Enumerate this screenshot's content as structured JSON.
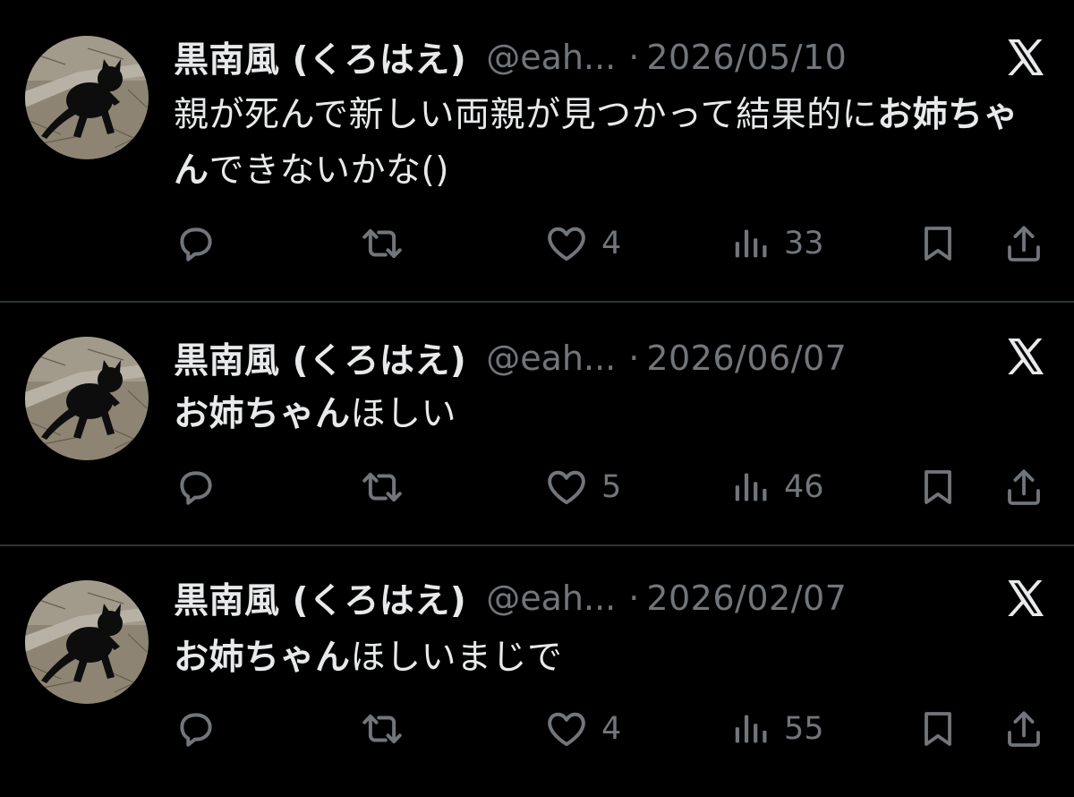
{
  "colors": {
    "background": "#000000",
    "primary_text": "#e7e9ea",
    "secondary_text": "#71767b",
    "divider": "#2f3336"
  },
  "icons": {
    "reply": "reply-icon",
    "retweet": "retweet-icon",
    "like": "heart-icon",
    "views": "views-icon",
    "bookmark": "bookmark-icon",
    "share": "share-icon",
    "brand": "x-logo-icon"
  },
  "tweets": [
    {
      "author_name": "黒南風 (くろはえ)",
      "handle": "@eah...",
      "separator": "·",
      "date": "2026/05/10",
      "text_parts": [
        {
          "text": "親が死んで新しい両親が見つかって結果的に",
          "bold": false
        },
        {
          "text": "お姉ちゃん",
          "bold": true
        },
        {
          "text": "できないかな()",
          "bold": false
        }
      ],
      "likes": "4",
      "views": "33"
    },
    {
      "author_name": "黒南風 (くろはえ)",
      "handle": "@eah...",
      "separator": "·",
      "date": "2026/06/07",
      "text_parts": [
        {
          "text": "お姉ちゃん",
          "bold": true
        },
        {
          "text": "ほしい",
          "bold": false
        }
      ],
      "likes": "5",
      "views": "46"
    },
    {
      "author_name": "黒南風 (くろはえ)",
      "handle": "@eah...",
      "separator": "·",
      "date": "2026/02/07",
      "text_parts": [
        {
          "text": "お姉ちゃん",
          "bold": true
        },
        {
          "text": "ほしいまじで",
          "bold": false
        }
      ],
      "likes": "4",
      "views": "55"
    }
  ]
}
